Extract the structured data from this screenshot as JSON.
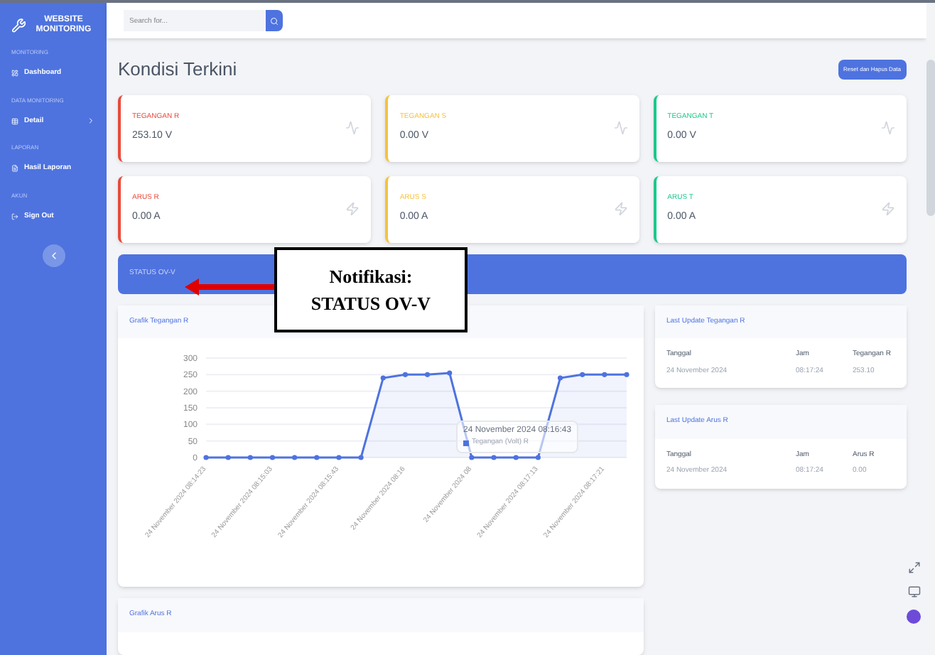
{
  "sidebar": {
    "brand": "WEBSITE MONITORING",
    "sections": [
      {
        "heading": "MONITORING",
        "items": [
          {
            "label": "Dashboard",
            "expandable": false
          }
        ]
      },
      {
        "heading": "DATA MONITORING",
        "items": [
          {
            "label": "Detail",
            "expandable": true
          }
        ]
      },
      {
        "heading": "LAPORAN",
        "items": [
          {
            "label": "Hasil Laporan",
            "expandable": false
          }
        ]
      },
      {
        "heading": "AKUN",
        "items": [
          {
            "label": "Sign Out",
            "expandable": false
          }
        ]
      }
    ]
  },
  "search": {
    "placeholder": "Search for..."
  },
  "page_title": "Kondisi Terkini",
  "reset_button": "Reset dan Hapus Data",
  "cards": [
    {
      "label": "TEGANGAN R",
      "value": "253.10 V",
      "color": "#e74a3b",
      "kind": "voltage"
    },
    {
      "label": "TEGANGAN S",
      "value": "0.00 V",
      "color": "#f6c23e",
      "kind": "voltage"
    },
    {
      "label": "TEGANGAN T",
      "value": "0.00 V",
      "color": "#1cc88a",
      "kind": "voltage"
    },
    {
      "label": "ARUS R",
      "value": "0.00 A",
      "color": "#e74a3b",
      "kind": "current"
    },
    {
      "label": "ARUS S",
      "value": "0.00 A",
      "color": "#f6c23e",
      "kind": "current"
    },
    {
      "label": "ARUS T",
      "value": "0.00 A",
      "color": "#1cc88a",
      "kind": "current"
    }
  ],
  "status_banner": "STATUS OV-V",
  "callout": {
    "title": "Notifikasi:",
    "text": "STATUS OV-V"
  },
  "chart_panel": {
    "title": "Grafik Tegangan R",
    "chart_data": {
      "type": "area",
      "grid": true,
      "marker": true,
      "categories": [
        "24 November 2024 08:14:23",
        null,
        null,
        "24 November 2024 08:15:03",
        null,
        null,
        "24 November 2024 08:15:43",
        null,
        null,
        "24 November 2024 08:16",
        null,
        null,
        "24 November 2024 08",
        null,
        null,
        "24 November 2024 08:17:13",
        null,
        null,
        "24 November 2024 08:17:21",
        null
      ],
      "ylim": [
        0,
        300
      ],
      "yticks": [
        0,
        50,
        100,
        150,
        200,
        250,
        300
      ],
      "series": [
        {
          "name": "Tegangan (Volt) R",
          "color": "#4e73df",
          "values": [
            0,
            0,
            0,
            0,
            0,
            0,
            0,
            0,
            240,
            250,
            250,
            255,
            0,
            0,
            0,
            0,
            240,
            250,
            250,
            250
          ]
        }
      ]
    },
    "tooltip": {
      "title": "24 November 2024 08:16:43"
    }
  },
  "second_panel": {
    "title": "Grafik Arus R"
  },
  "updates": [
    {
      "title": "Last Update Tegangan R",
      "columns": [
        "Tanggal",
        "Jam",
        "Tegangan R"
      ],
      "row": [
        "24 November 2024",
        "08:17:24",
        "253.10"
      ]
    },
    {
      "title": "Last Update Arus R",
      "columns": [
        "Tanggal",
        "Jam",
        "Arus R"
      ],
      "row": [
        "24 November 2024",
        "08:17:24",
        "0.00"
      ]
    }
  ]
}
